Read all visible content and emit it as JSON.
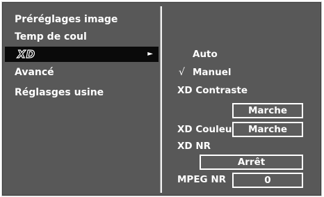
{
  "left_menu": {
    "items": [
      {
        "label": "Préréglages image"
      },
      {
        "label": "Temp de coul"
      },
      {
        "label": "XD",
        "active": true
      },
      {
        "label": "Avancé"
      },
      {
        "label": "Réglasges usine"
      }
    ],
    "submenu_arrow": "►"
  },
  "right_panel": {
    "options": {
      "auto": "Auto",
      "manuel": "Manuel",
      "check_mark": "√"
    },
    "xd_contraste": {
      "label": "XD Contraste",
      "value": "Marche"
    },
    "xd_couleur": {
      "label": "XD Couleur",
      "value": "Marche"
    },
    "xd_nr": {
      "label": "XD NR",
      "value": "Arrêt"
    },
    "mpeg_nr": {
      "label": "MPEG NR",
      "value": "0"
    }
  },
  "colors": {
    "background": "#585858",
    "highlight": "#0a0a0a",
    "text": "#ffffff"
  },
  "icons": [
    "submenu-arrow-icon",
    "checkmark-icon",
    "xd-logo-icon"
  ]
}
